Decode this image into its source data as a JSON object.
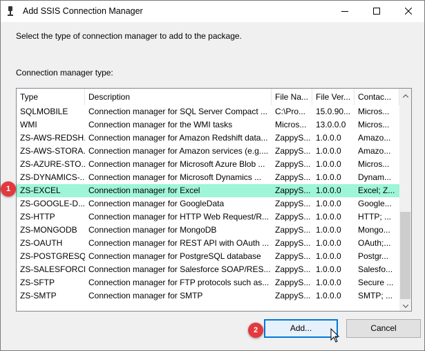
{
  "window": {
    "title": "Add SSIS Connection Manager"
  },
  "prompt": "Select the type of connection manager to add to the package.",
  "list_label": "Connection manager type:",
  "columns": [
    "Type",
    "Description",
    "File Na...",
    "File Ver...",
    "Contac..."
  ],
  "rows": [
    [
      "SQLMOBILE",
      "Connection manager for SQL Server Compact ...",
      "C:\\Pro...",
      "15.0.90...",
      "Micros..."
    ],
    [
      "WMI",
      "Connection manager for the WMI tasks",
      "Micros...",
      "13.0.0.0",
      "Micros..."
    ],
    [
      "ZS-AWS-REDSH...",
      "Connection manager for Amazon Redshift data...",
      "ZappyS...",
      "1.0.0.0",
      "Amazo..."
    ],
    [
      "ZS-AWS-STORA...",
      "Connection manager for Amazon services (e.g....",
      "ZappyS...",
      "1.0.0.0",
      "Amazo..."
    ],
    [
      "ZS-AZURE-STO...",
      "Connection manager for Microsoft Azure Blob ...",
      "ZappyS...",
      "1.0.0.0",
      "Micros..."
    ],
    [
      "ZS-DYNAMICS-...",
      "Connection manager for Microsoft Dynamics ...",
      "ZappyS...",
      "1.0.0.0",
      "Dynam..."
    ],
    [
      "ZS-EXCEL",
      "Connection manager for Excel",
      "ZappyS...",
      "1.0.0.0",
      "Excel; Z..."
    ],
    [
      "ZS-GOOGLE-D...",
      "Connection manager for GoogleData",
      "ZappyS...",
      "1.0.0.0",
      "Google..."
    ],
    [
      "ZS-HTTP",
      "Connection manager for HTTP Web Request/R...",
      "ZappyS...",
      "1.0.0.0",
      "HTTP; ..."
    ],
    [
      "ZS-MONGODB",
      "Connection manager for MongoDB",
      "ZappyS...",
      "1.0.0.0",
      "Mongo..."
    ],
    [
      "ZS-OAUTH",
      "Connection manager for REST API with OAuth ...",
      "ZappyS...",
      "1.0.0.0",
      "OAuth;..."
    ],
    [
      "ZS-POSTGRESQL",
      "Connection manager for PostgreSQL database",
      "ZappyS...",
      "1.0.0.0",
      "Postgr..."
    ],
    [
      "ZS-SALESFORCE",
      "Connection manager for Salesforce SOAP/RES...",
      "ZappyS...",
      "1.0.0.0",
      "Salesfo..."
    ],
    [
      "ZS-SFTP",
      "Connection manager for FTP protocols such as...",
      "ZappyS...",
      "1.0.0.0",
      "Secure ..."
    ],
    [
      "ZS-SMTP",
      "Connection manager for SMTP",
      "ZappyS...",
      "1.0.0.0",
      "SMTP; ..."
    ]
  ],
  "selected_row": 6,
  "buttons": {
    "add": "Add...",
    "cancel": "Cancel"
  },
  "callouts": {
    "step1": "1",
    "step2": "2"
  },
  "colors": {
    "selection": "#9ef5d8",
    "callout": "#e3393e",
    "focus_border": "#0078d7"
  },
  "icons": {
    "app": "ssis-package-icon",
    "minimize": "minimize-icon",
    "maximize": "maximize-icon",
    "close": "close-icon",
    "cursor": "mouse-pointer-icon"
  }
}
